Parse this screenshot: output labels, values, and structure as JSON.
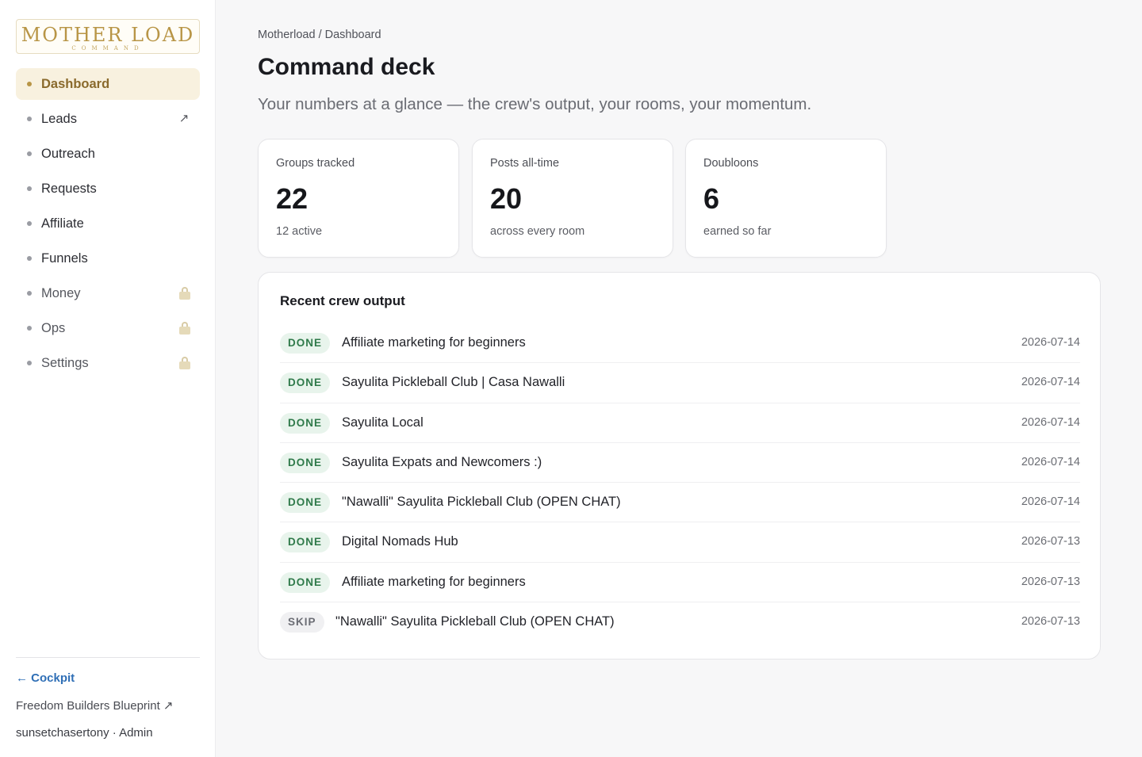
{
  "sidebar": {
    "logo_main": "MOTHER LOAD",
    "logo_sub": "COMMAND",
    "items": [
      {
        "label": "Dashboard",
        "active": true
      },
      {
        "label": "Leads",
        "trailing": "↗"
      },
      {
        "label": "Outreach"
      },
      {
        "label": "Requests"
      },
      {
        "label": "Affiliate"
      },
      {
        "label": "Funnels"
      },
      {
        "label": "Money",
        "locked": true
      },
      {
        "label": "Ops",
        "locked": true
      },
      {
        "label": "Settings",
        "locked": true
      }
    ],
    "cockpit_label": "← Cockpit",
    "blueprint_label": "Freedom Builders Blueprint ↗",
    "user_label": "sunsetchasertony · Admin"
  },
  "header": {
    "breadcrumb": "Motherload / Dashboard",
    "title": "Command deck",
    "subtitle": "Your numbers at a glance — the crew's output, your rooms, your momentum."
  },
  "stats": [
    {
      "label": "Groups tracked",
      "value": "22",
      "note": "12 active"
    },
    {
      "label": "Posts all-time",
      "value": "20",
      "note": "across every room"
    },
    {
      "label": "Doubloons",
      "value": "6",
      "note": "earned so far"
    }
  ],
  "output": {
    "title": "Recent crew output",
    "rows": [
      {
        "status": "DONE",
        "title": "Affiliate marketing for beginners",
        "date": "2026-07-14"
      },
      {
        "status": "DONE",
        "title": "Sayulita Pickleball Club | Casa Nawalli",
        "date": "2026-07-14"
      },
      {
        "status": "DONE",
        "title": "Sayulita Local",
        "date": "2026-07-14"
      },
      {
        "status": "DONE",
        "title": "Sayulita Expats and Newcomers :)",
        "date": "2026-07-14"
      },
      {
        "status": "DONE",
        "title": "\"Nawalli\" Sayulita Pickleball Club (OPEN CHAT)",
        "date": "2026-07-14"
      },
      {
        "status": "DONE",
        "title": "Digital Nomads Hub",
        "date": "2026-07-13"
      },
      {
        "status": "DONE",
        "title": "Affiliate marketing for beginners",
        "date": "2026-07-13"
      },
      {
        "status": "SKIP",
        "title": "\"Nawalli\" Sayulita Pickleball Club (OPEN CHAT)",
        "date": "2026-07-13"
      }
    ]
  },
  "colors": {
    "accent_gold": "#b89546",
    "active_bg": "#f8f1df",
    "link_blue": "#2f6fb6",
    "done_green": "#2f7a4a",
    "done_bg": "#e8f4ec"
  }
}
